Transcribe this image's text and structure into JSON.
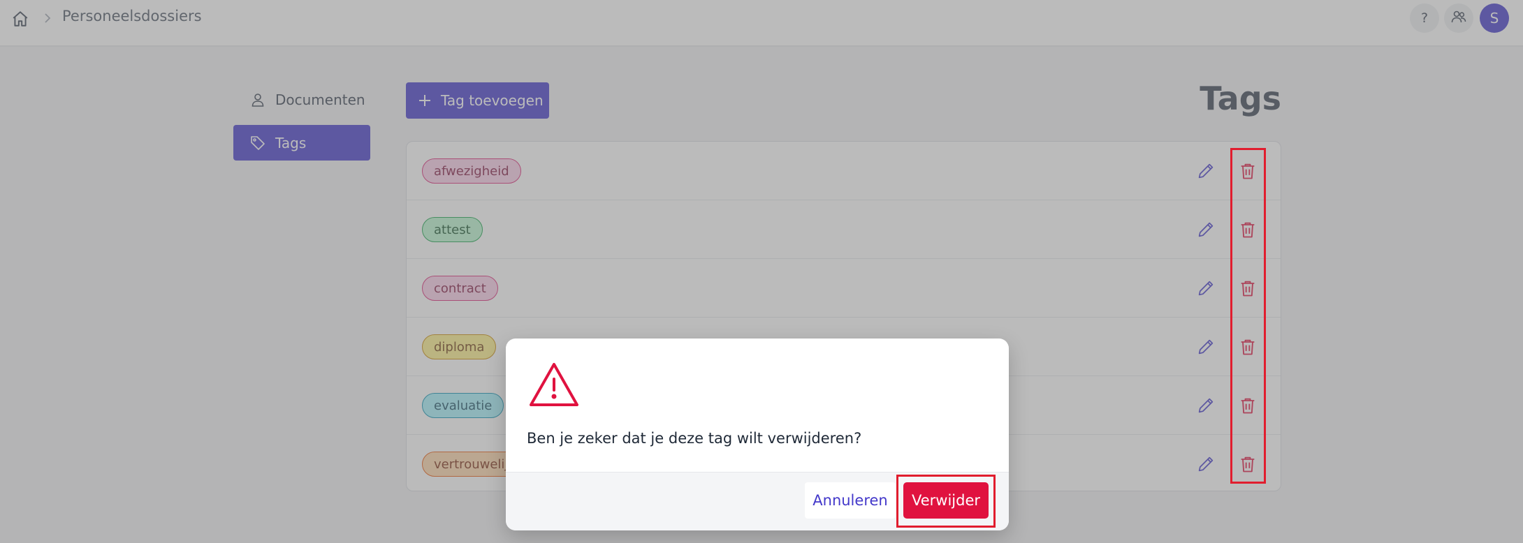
{
  "header": {
    "breadcrumb": "Personeelsdossiers",
    "help_label": "?",
    "avatar_initial": "S"
  },
  "sidebar": {
    "items": [
      {
        "label": "Documenten",
        "icon": "user-icon",
        "active": false
      },
      {
        "label": "Tags",
        "icon": "tag-icon",
        "active": true
      }
    ]
  },
  "main": {
    "add_button_label": "Tag toevoegen",
    "title": "Tags",
    "tags": [
      {
        "label": "afwezigheid",
        "bg": "#fbcfe8",
        "border": "#db2777",
        "text": "#831843"
      },
      {
        "label": "attest",
        "bg": "#bbf7d0",
        "border": "#16a34a",
        "text": "#14532d"
      },
      {
        "label": "contract",
        "bg": "#fbcfe8",
        "border": "#db2777",
        "text": "#831843"
      },
      {
        "label": "diploma",
        "bg": "#fef08a",
        "border": "#ca8a04",
        "text": "#713f12"
      },
      {
        "label": "evaluatie",
        "bg": "#a5f3fc",
        "border": "#0891b2",
        "text": "#164e63"
      },
      {
        "label": "vertrouwelijk",
        "bg": "#fed7aa",
        "border": "#ea580c",
        "text": "#7c2d12"
      }
    ]
  },
  "modal": {
    "message": "Ben je zeker dat je deze tag wilt verwijderen?",
    "cancel_label": "Annuleren",
    "confirm_label": "Verwijder"
  },
  "colors": {
    "accent": "#4338ca",
    "danger": "#e0123f",
    "highlight": "#e11d2e"
  }
}
